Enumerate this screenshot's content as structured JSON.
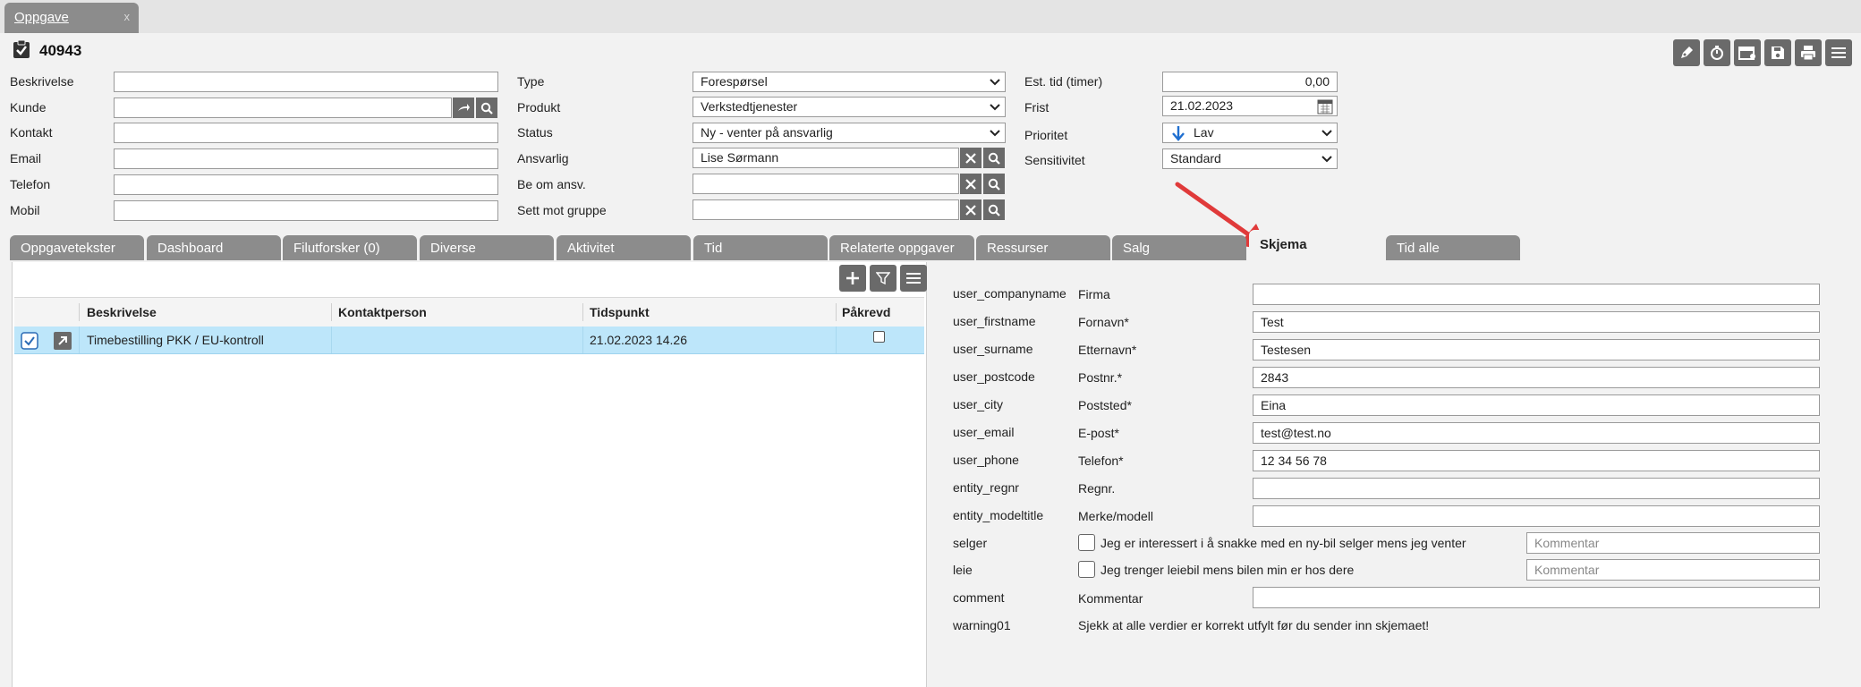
{
  "doc_tab": {
    "label": "Oppgave",
    "close": "x"
  },
  "record": {
    "id": "40943"
  },
  "toolbar": {
    "icons": [
      "pen-icon",
      "stopwatch-icon",
      "calendar-icon",
      "save-icon",
      "print-icon",
      "menu-icon"
    ]
  },
  "form_left": {
    "beskrivelse": {
      "label": "Beskrivelse",
      "value": ""
    },
    "kunde": {
      "label": "Kunde",
      "value": ""
    },
    "kontakt": {
      "label": "Kontakt",
      "value": ""
    },
    "email": {
      "label": "Email",
      "value": ""
    },
    "telefon": {
      "label": "Telefon",
      "value": ""
    },
    "mobil": {
      "label": "Mobil",
      "value": ""
    }
  },
  "form_mid": {
    "type": {
      "label": "Type",
      "value": "Forespørsel"
    },
    "produkt": {
      "label": "Produkt",
      "value": "Verkstedtjenester"
    },
    "status": {
      "label": "Status",
      "value": "Ny - venter på ansvarlig"
    },
    "ansvarlig": {
      "label": "Ansvarlig",
      "value": "Lise Sørmann"
    },
    "be_om_ansv": {
      "label": "Be om ansv.",
      "value": ""
    },
    "sett_mot_gruppe": {
      "label": "Sett mot gruppe",
      "value": ""
    }
  },
  "form_right": {
    "est_tid": {
      "label": "Est. tid (timer)",
      "value": "0,00"
    },
    "frist": {
      "label": "Frist",
      "value": "21.02.2023"
    },
    "prioritet": {
      "label": "Prioritet",
      "value": "Lav"
    },
    "sensitivitet": {
      "label": "Sensitivitet",
      "value": "Standard"
    }
  },
  "tabs": [
    {
      "label": "Oppgavetekster"
    },
    {
      "label": "Dashboard"
    },
    {
      "label": "Filutforsker (0)"
    },
    {
      "label": "Diverse"
    },
    {
      "label": "Aktivitet"
    },
    {
      "label": "Tid"
    },
    {
      "label": "Relaterte oppgaver"
    },
    {
      "label": "Ressurser"
    },
    {
      "label": "Salg"
    },
    {
      "label": "Skjema"
    },
    {
      "label": "Tid alle"
    }
  ],
  "grid": {
    "headers": [
      "Beskrivelse",
      "Kontaktperson",
      "Tidspunkt",
      "Påkrevd"
    ],
    "rows": [
      {
        "beskrivelse": "Timebestilling PKK / EU-kontroll",
        "kontaktperson": "",
        "tidspunkt": "21.02.2023 14.26",
        "pakrevd": false
      }
    ]
  },
  "schema": {
    "rows": [
      {
        "key": "user_companyname",
        "label": "Firma",
        "value": ""
      },
      {
        "key": "user_firstname",
        "label": "Fornavn*",
        "value": "Test"
      },
      {
        "key": "user_surname",
        "label": "Etternavn*",
        "value": "Testesen"
      },
      {
        "key": "user_postcode",
        "label": "Postnr.*",
        "value": "2843"
      },
      {
        "key": "user_city",
        "label": "Poststed*",
        "value": "Eina"
      },
      {
        "key": "user_email",
        "label": "E-post*",
        "value": "test@test.no"
      },
      {
        "key": "user_phone",
        "label": "Telefon*",
        "value": "12 34 56 78"
      },
      {
        "key": "entity_regnr",
        "label": "Regnr.",
        "value": ""
      },
      {
        "key": "entity_modeltitle",
        "label": "Merke/modell",
        "value": ""
      }
    ],
    "selger": {
      "key": "selger",
      "text": "Jeg er interessert i å snakke med en ny-bil selger mens jeg venter",
      "placeholder": "Kommentar"
    },
    "leie": {
      "key": "leie",
      "text": "Jeg trenger leiebil mens bilen min er hos dere",
      "placeholder": "Kommentar"
    },
    "comment": {
      "key": "comment",
      "label": "Kommentar",
      "value": ""
    },
    "warning": {
      "key": "warning01",
      "text": "Sjekk at alle verdier er korrekt utfylt før du sender inn skjemaet!"
    }
  },
  "colors": {
    "tab_bg": "#8c8c8c",
    "selected_row": "#bde6fa",
    "arrow": "#e03a3a",
    "priority_arrow": "#1f6fd0"
  }
}
